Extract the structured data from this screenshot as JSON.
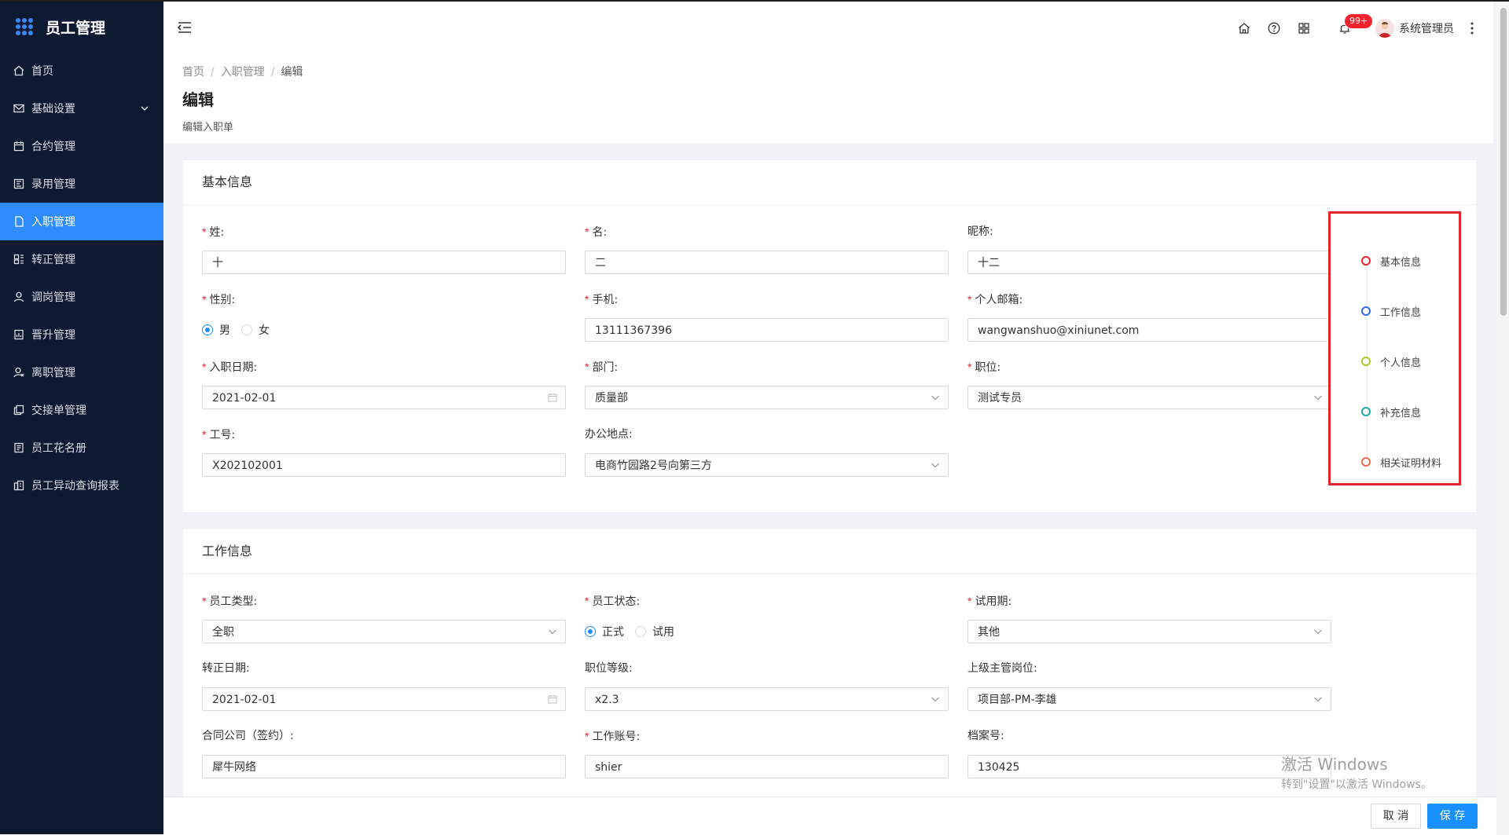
{
  "app": {
    "title": "员工管理"
  },
  "sidebar": {
    "items": [
      {
        "label": "首页",
        "icon": "home-icon"
      },
      {
        "label": "基础设置",
        "icon": "mail-icon",
        "expandable": true
      },
      {
        "label": "合约管理",
        "icon": "calendar-icon"
      },
      {
        "label": "录用管理",
        "icon": "board-icon"
      },
      {
        "label": "入职管理",
        "icon": "document-icon",
        "active": true
      },
      {
        "label": "转正管理",
        "icon": "layout-icon"
      },
      {
        "label": "调岗管理",
        "icon": "user-icon"
      },
      {
        "label": "晋升管理",
        "icon": "chart-doc-icon"
      },
      {
        "label": "离职管理",
        "icon": "user-leave-icon"
      },
      {
        "label": "交接单管理",
        "icon": "copy-icon"
      },
      {
        "label": "员工花名册",
        "icon": "roster-icon"
      },
      {
        "label": "员工异动查询报表",
        "icon": "report-icon"
      }
    ]
  },
  "header": {
    "notification_badge": "99+",
    "username": "系统管理员"
  },
  "breadcrumb": {
    "items": [
      "首页",
      "入职管理",
      "编辑"
    ]
  },
  "page": {
    "title": "编辑",
    "subtitle": "编辑入职单"
  },
  "basic_info": {
    "title": "基本信息",
    "surname": {
      "label": "姓:",
      "value": "十"
    },
    "given_name": {
      "label": "名:",
      "value": "二"
    },
    "nickname": {
      "label": "昵称:",
      "value": "十二"
    },
    "gender": {
      "label": "性别:",
      "options": [
        "男",
        "女"
      ],
      "selected": "男"
    },
    "phone": {
      "label": "手机:",
      "value": "13111367396"
    },
    "email": {
      "label": "个人邮箱:",
      "value": "wangwanshuo@xiniunet.com"
    },
    "entry_date": {
      "label": "入职日期:",
      "value": "2021-02-01"
    },
    "department": {
      "label": "部门:",
      "value": "质量部"
    },
    "position": {
      "label": "职位:",
      "value": "测试专员"
    },
    "employee_no": {
      "label": "工号:",
      "value": "X202102001"
    },
    "office": {
      "label": "办公地点:",
      "value": "电商竹园路2号向第三方"
    }
  },
  "work_info": {
    "title": "工作信息",
    "employee_type": {
      "label": "员工类型:",
      "value": "全职"
    },
    "employee_status": {
      "label": "员工状态:",
      "options": [
        "正式",
        "试用"
      ],
      "selected": "正式"
    },
    "probation": {
      "label": "试用期:",
      "value": "其他"
    },
    "regular_date": {
      "label": "转正日期:",
      "value": "2021-02-01"
    },
    "position_level": {
      "label": "职位等级:",
      "value": "x2.3"
    },
    "supervisor": {
      "label": "上级主管岗位:",
      "value": "项目部-PM-李雄"
    },
    "contract_company": {
      "label": "合同公司（签约）:",
      "value": "犀牛网络"
    },
    "work_account": {
      "label": "工作账号:",
      "value": "shier"
    },
    "archive_no": {
      "label": "档案号:",
      "value": "130425"
    }
  },
  "anchor_nav": {
    "items": [
      {
        "label": "基本信息",
        "color": "#e8242b"
      },
      {
        "label": "工作信息",
        "color": "#2f6fd6"
      },
      {
        "label": "个人信息",
        "color": "#a6c92a"
      },
      {
        "label": "补充信息",
        "color": "#21a7a5"
      },
      {
        "label": "相关证明材料",
        "color": "#e26f4c"
      }
    ]
  },
  "watermark": {
    "line1": "激活 Windows",
    "line2": "转到\"设置\"以激活 Windows。"
  },
  "footer": {
    "cancel": "取 消",
    "save": "保 存"
  },
  "colors": {
    "sidebar_bg": "#0e1a31",
    "accent": "#1890ff",
    "active_menu": "#2f8cff"
  }
}
